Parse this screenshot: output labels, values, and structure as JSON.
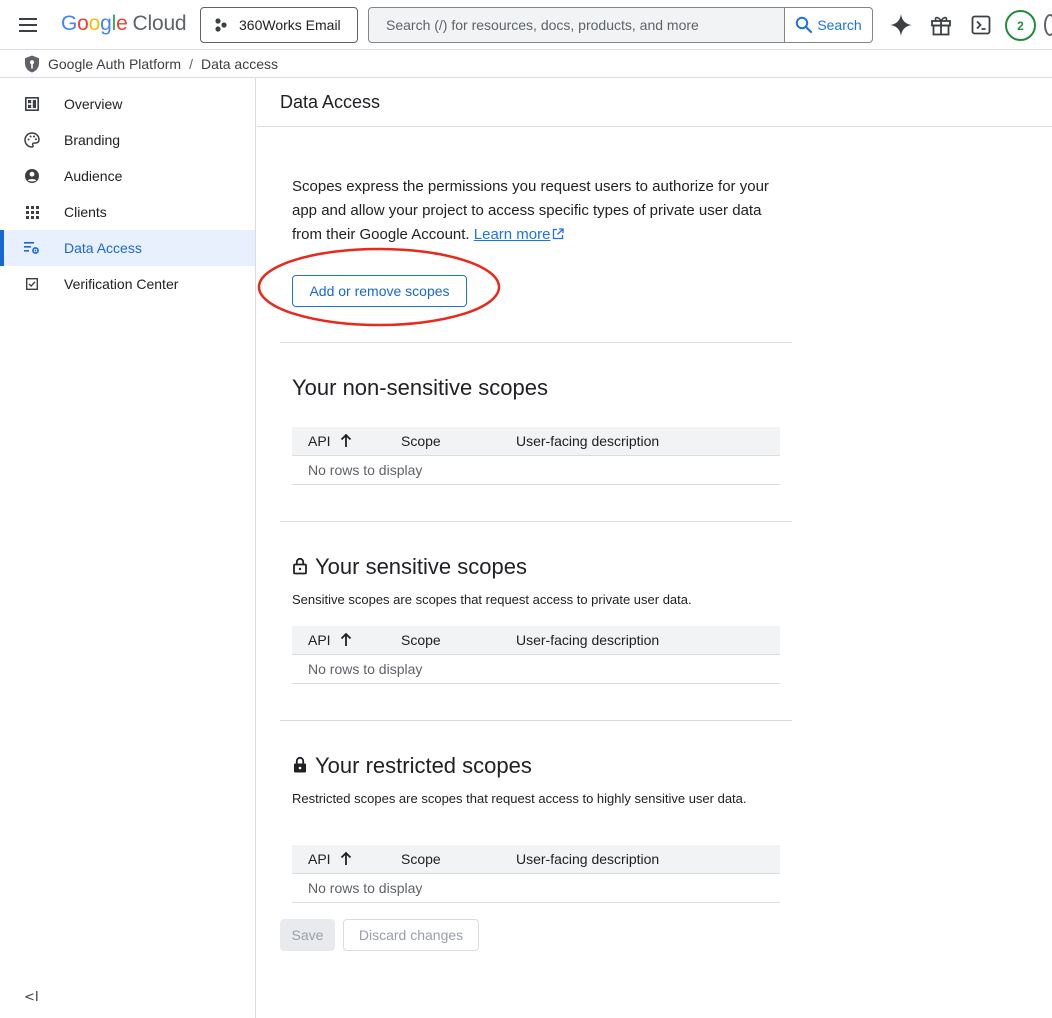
{
  "header": {
    "logo_google": "Google",
    "logo_cloud": "Cloud",
    "project_label": "360Works Email",
    "search_placeholder": "Search (/) for resources, docs, products, and more",
    "search_button_label": "Search",
    "avatar_text": "2"
  },
  "icons": {
    "menu": "hamburger-menu-icon",
    "project": "project-dots-icon",
    "search": "magnifier-icon",
    "gemini": "sparkle-icon",
    "gift": "gift-icon",
    "terminal": "cloud-shell-icon",
    "breadcrumb": "shield-key-icon",
    "collapse": "collapse-sidebar-icon"
  },
  "breadcrumb": {
    "product": "Google Auth Platform",
    "separator": "/",
    "current": "Data access"
  },
  "sidebar": {
    "items": [
      {
        "label": "Overview",
        "icon": "dashboard-icon",
        "active": false
      },
      {
        "label": "Branding",
        "icon": "palette-icon",
        "active": false
      },
      {
        "label": "Audience",
        "icon": "person-circle-icon",
        "active": false
      },
      {
        "label": "Clients",
        "icon": "grid-icon",
        "active": false
      },
      {
        "label": "Data Access",
        "icon": "data-access-icon",
        "active": true
      },
      {
        "label": "Verification Center",
        "icon": "checkbox-icon",
        "active": false
      }
    ],
    "collapse_label": "<I"
  },
  "main": {
    "title": "Data Access",
    "intro_text": "Scopes express the permissions you request users to authorize for your app and allow your project to access specific types of private user data from their Google Account.",
    "learn_more": "Learn more",
    "scopes_button": "Add or remove scopes",
    "table_headers": {
      "api": "API",
      "scope": "Scope",
      "description": "User-facing description"
    },
    "empty_text": "No rows to display",
    "sections": [
      {
        "title": "Your non-sensitive scopes",
        "description": "",
        "locked": false
      },
      {
        "title": "Your sensitive scopes",
        "description": "Sensitive scopes are scopes that request access to private user data.",
        "locked": true
      },
      {
        "title": "Your restricted scopes",
        "description": "Restricted scopes are scopes that request access to highly sensitive user data.",
        "locked": true
      }
    ],
    "save_button": "Save",
    "discard_button": "Discard changes"
  },
  "colors": {
    "accent": "#1a73e8",
    "active_nav_bg": "#e8f0fe",
    "highlight_ring": "#e8291c",
    "avatar_ring": "#1e8e3e"
  }
}
